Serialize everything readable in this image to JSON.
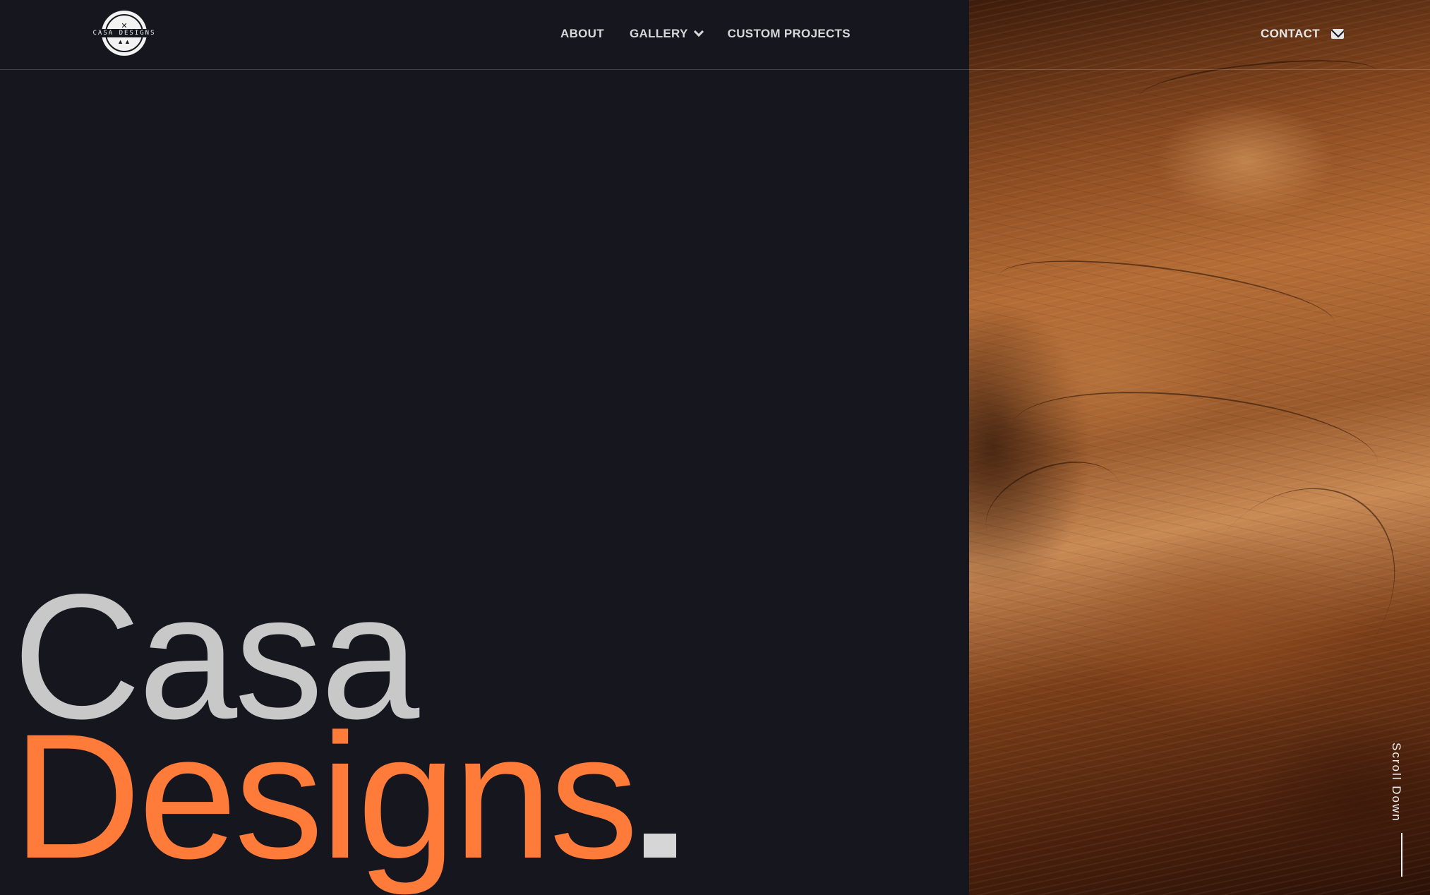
{
  "brand": {
    "logo_text": "CASA DESIGNS"
  },
  "nav": {
    "items": [
      {
        "label": "ABOUT"
      },
      {
        "label": "GALLERY"
      },
      {
        "label": "CUSTOM PROJECTS"
      }
    ],
    "contact_label": "CONTACT"
  },
  "hero": {
    "line1": "Casa",
    "line2": "Designs"
  },
  "scroll": {
    "label": "Scroll Down"
  },
  "colors": {
    "background": "#16161f",
    "accent": "#ff7b3a",
    "hero_gray": "#c8c8c8"
  },
  "icons": {
    "gallery_dropdown": "chevron-down-icon",
    "contact": "mail-icon"
  }
}
